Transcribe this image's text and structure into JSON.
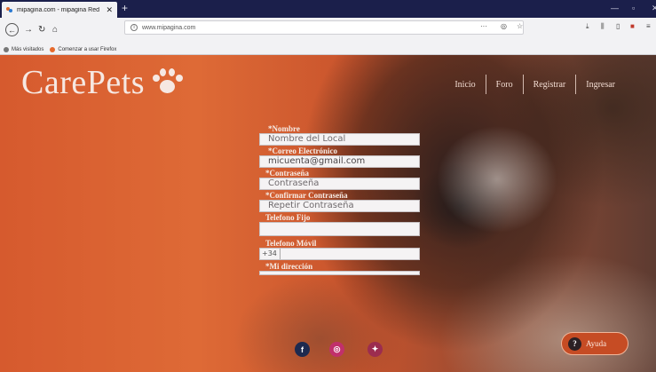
{
  "browser": {
    "tab_title": "mipagina.com - mipagina Red",
    "tab_close": "✕",
    "new_tab": "+",
    "url": "www.mipagina.com",
    "url_actions": "···",
    "bookmarks": [
      "Más visitados",
      "Comenzar a usar Firefox"
    ]
  },
  "site": {
    "brand": "CarePets",
    "nav": [
      "Inicio",
      "Foro",
      "Registrar",
      "Ingresar"
    ]
  },
  "form": {
    "nombre_label": "*Nombre",
    "nombre_placeholder": "Nombre del Local",
    "correo_label": "*Correo Electrónico",
    "correo_value": "micuenta@gmail.com",
    "contrasena_label": "*Contraseña",
    "contrasena_placeholder": "Contraseña",
    "confirmar_label": "*Confirmar Contraseña",
    "confirmar_placeholder": "Repetir Contraseña",
    "telefono_fijo_label": "Telefono Fijo",
    "telefono_movil_label": "Telefono Móvil",
    "telefono_prefix": "+34",
    "direccion_label": "*Mi dirección"
  },
  "footer": {
    "social_icons": [
      "facebook-icon",
      "instagram-icon",
      "twitter-icon"
    ],
    "help_label": "Ayuda",
    "help_icon": "?"
  },
  "colors": {
    "background_orange": "#d65a2e",
    "help_button": "#c64c24",
    "facebook": "#1e2a4f",
    "instagram": "#c1306b",
    "twitter": "#9c2c4f",
    "browser_frame": "#1b1f4b"
  }
}
